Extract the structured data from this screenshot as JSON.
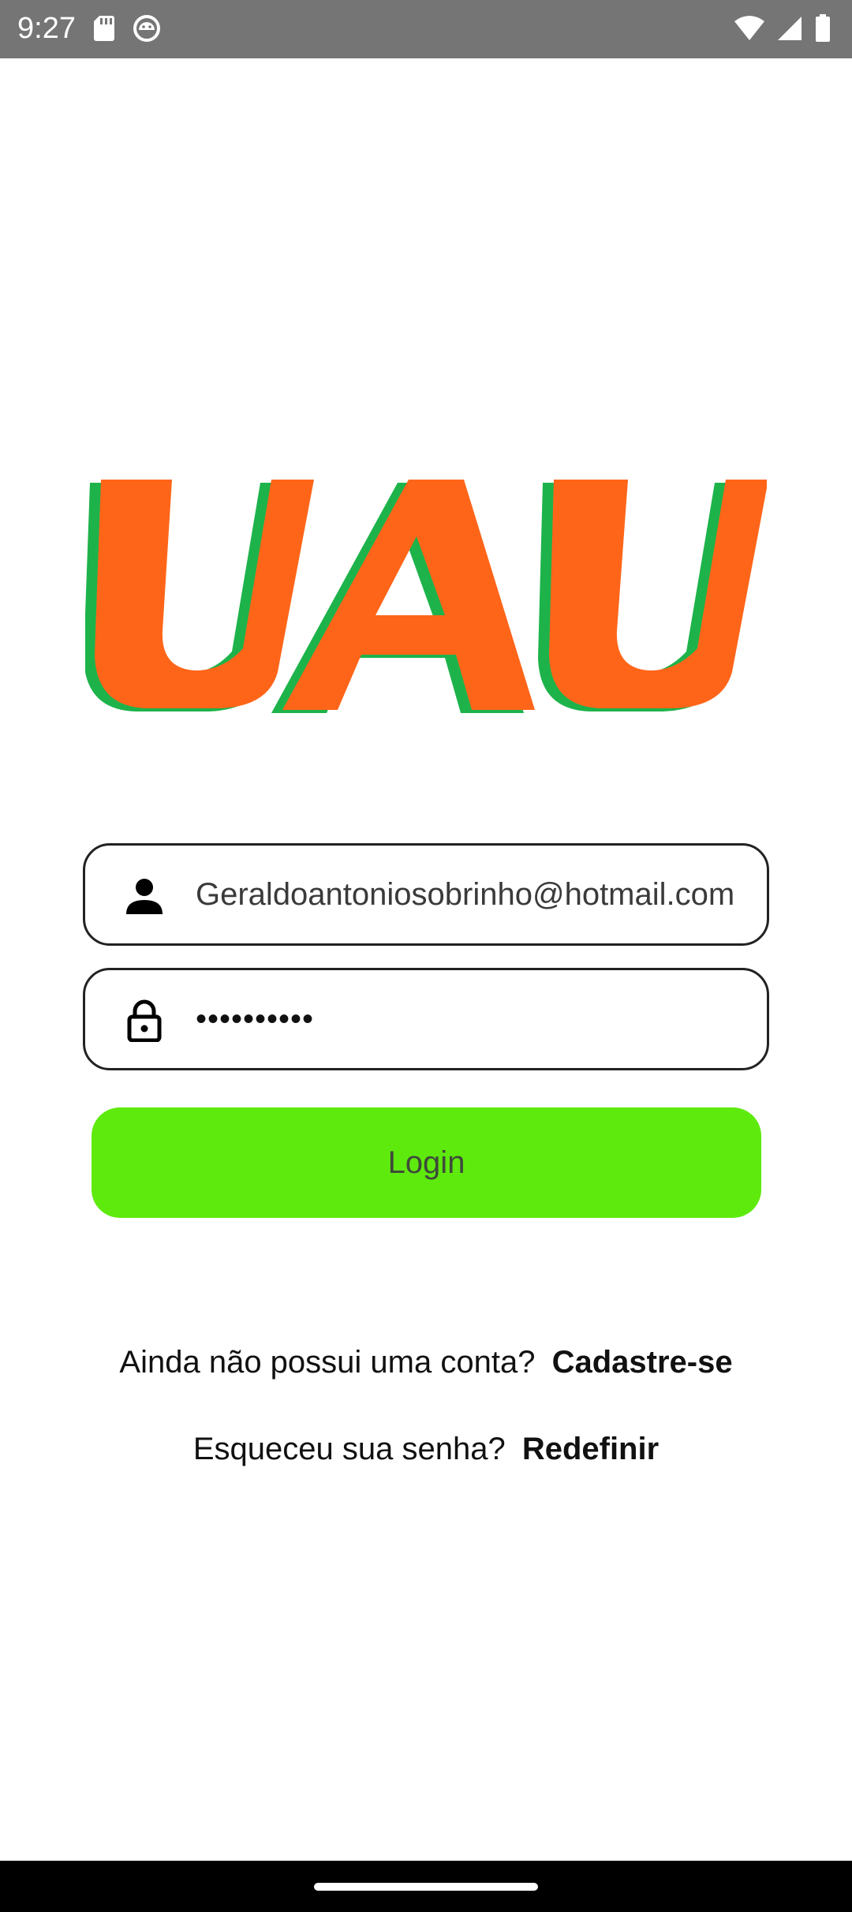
{
  "status_bar": {
    "time": "9:27",
    "left_icons": [
      "sd-card-icon",
      "android-notification-icon"
    ],
    "right_icons": [
      "wifi-icon",
      "cellular-signal-icon",
      "battery-icon"
    ]
  },
  "logo": {
    "text": "UAU",
    "colors": {
      "primary": "#ff6519",
      "shadow": "#1db34a"
    }
  },
  "login_form": {
    "email": {
      "icon": "person-icon",
      "value": "Geraldoantoniosobrinho@hotmail.com"
    },
    "password": {
      "icon": "lock-icon",
      "masked_value": "••••••••••"
    },
    "login_button": "Login"
  },
  "links": {
    "signup_prompt": "Ainda não possui uma conta?",
    "signup_link": "Cadastre-se",
    "reset_prompt": "Esqueceu sua senha?",
    "reset_link": "Redefinir"
  },
  "theme": {
    "accent_green": "#5fea0e",
    "status_bar": "#757575"
  }
}
